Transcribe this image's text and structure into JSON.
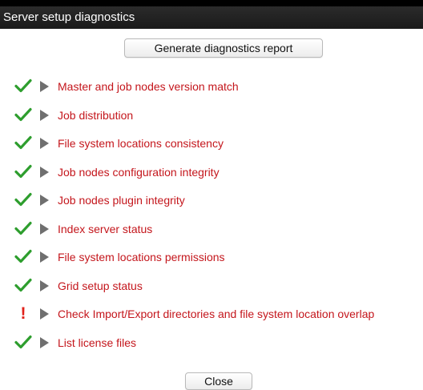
{
  "window": {
    "title": "Server setup diagnostics"
  },
  "actions": {
    "generate_label": "Generate diagnostics report",
    "close_label": "Close"
  },
  "checks": [
    {
      "label": "Master and job nodes version match",
      "status": "ok",
      "status_icon": "check-icon"
    },
    {
      "label": "Job distribution",
      "status": "ok",
      "status_icon": "check-icon"
    },
    {
      "label": "File system locations consistency",
      "status": "ok",
      "status_icon": "check-icon"
    },
    {
      "label": "Job nodes configuration integrity",
      "status": "ok",
      "status_icon": "check-icon"
    },
    {
      "label": "Job nodes plugin integrity",
      "status": "ok",
      "status_icon": "check-icon"
    },
    {
      "label": "Index server status",
      "status": "ok",
      "status_icon": "check-icon"
    },
    {
      "label": "File system locations permissions",
      "status": "ok",
      "status_icon": "check-icon"
    },
    {
      "label": "Grid setup status",
      "status": "ok",
      "status_icon": "check-icon"
    },
    {
      "label": "Check Import/Export directories and file system location overlap",
      "status": "error",
      "status_icon": "exclamation-icon",
      "status_glyph": "!"
    },
    {
      "label": "List license files",
      "status": "ok",
      "status_icon": "check-icon"
    }
  ],
  "colors": {
    "title_bar": "#1a1a1a",
    "title_text": "#ffffff",
    "check_label": "#c4161c",
    "ok_icon": "#2e9e2e",
    "error_icon": "#e1211a",
    "expander": "#6f6f6f"
  }
}
